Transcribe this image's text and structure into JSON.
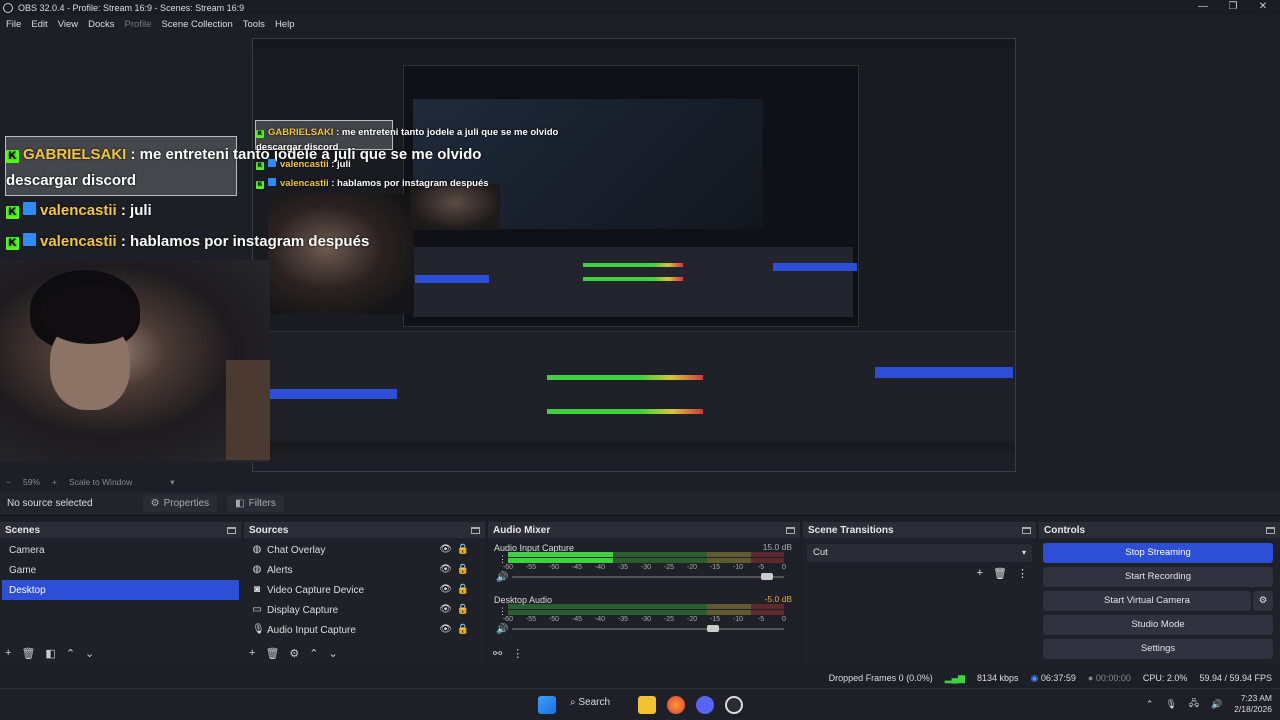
{
  "window": {
    "title": "OBS 32.0.4 - Profile: Stream 16:9 - Scenes: Stream 16:9"
  },
  "menu": [
    "File",
    "Edit",
    "View",
    "Docks",
    "Profile",
    "Scene Collection",
    "Tools",
    "Help"
  ],
  "chat": {
    "line1_user": "GABRIELSAKI",
    "line1_text": ": me entreteni tanto jodele a juli que se me olvido",
    "line1_text2": "descargar discord",
    "line2_user": "valencastii",
    "line2_text": ": juli",
    "line3_user": "valencastii",
    "line3_text": ": hablamos por instagram después"
  },
  "zoom": {
    "minus": "−",
    "value": "59%",
    "plus": "+",
    "mode": "Scale to Window"
  },
  "propbar": {
    "status": "No source selected",
    "properties": "Properties",
    "filters": "Filters"
  },
  "scenes": {
    "title": "Scenes",
    "items": [
      "Camera",
      "Game",
      "Desktop"
    ],
    "selected": "Desktop"
  },
  "sources": {
    "title": "Sources",
    "items": [
      {
        "label": "Chat Overlay",
        "icon": "globe-icon"
      },
      {
        "label": "Alerts",
        "icon": "globe-icon"
      },
      {
        "label": "Video Capture Device",
        "icon": "camera-icon"
      },
      {
        "label": "Display Capture",
        "icon": "monitor-icon"
      },
      {
        "label": "Audio Input Capture",
        "icon": "microphone-icon"
      }
    ]
  },
  "mixer": {
    "title": "Audio Mixer",
    "tracks": [
      {
        "name": "Audio Input Capture",
        "db": "15.0 dB",
        "level": 0.38,
        "volume": 0.96
      },
      {
        "name": "Desktop Audio",
        "db": "-5.0 dB",
        "level": 0.0,
        "volume": 0.76
      }
    ],
    "scale": [
      "-60",
      "-55",
      "-50",
      "-45",
      "-40",
      "-35",
      "-30",
      "-25",
      "-20",
      "-15",
      "-10",
      "-5",
      "0"
    ]
  },
  "transitions": {
    "title": "Scene Transitions",
    "selected": "Cut"
  },
  "controls": {
    "title": "Controls",
    "stop_streaming": "Stop Streaming",
    "start_recording": "Start Recording",
    "start_virtual_camera": "Start Virtual Camera",
    "studio_mode": "Studio Mode",
    "settings": "Settings"
  },
  "status": {
    "dropped": "Dropped Frames 0 (0.0%)",
    "bitrate": "8134 kbps",
    "stream_time": "06:37:59",
    "rec_time": "00:00:00",
    "cpu": "CPU: 2.0%",
    "fps": "59.94 / 59.94 FPS"
  },
  "taskbar": {
    "search": "Search",
    "time": "7:23 AM",
    "date": "2/18/2026"
  },
  "colors": {
    "accent": "#2c4fd6",
    "meter_green": "#3fd13f",
    "meter_yellow": "#d7c53b",
    "meter_red": "#d03a3a",
    "kick_green": "#53fc18"
  }
}
